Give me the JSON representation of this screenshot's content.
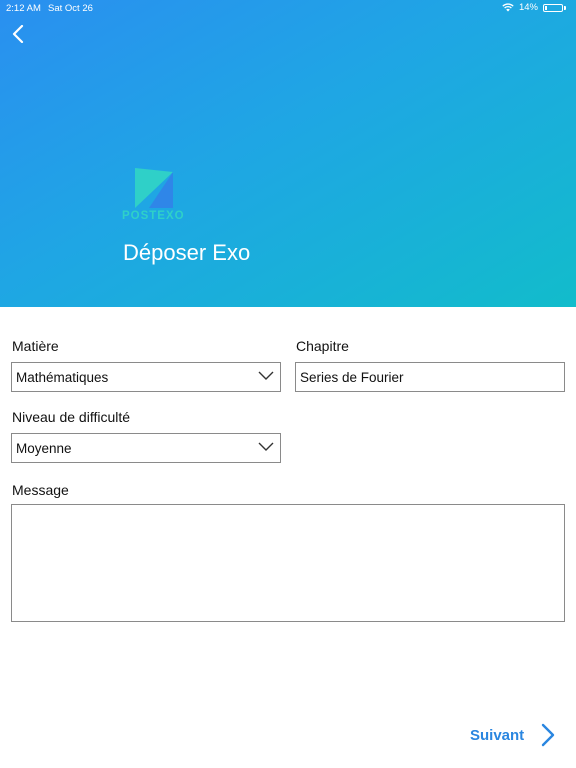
{
  "status_bar": {
    "time": "2:12 AM",
    "date": "Sat Oct 26",
    "battery": "14%",
    "battery_level": 0.14
  },
  "header": {
    "logo_text": "POSTEXO",
    "title": "Déposer Exo"
  },
  "form": {
    "subject": {
      "label": "Matière",
      "value": "Mathématiques"
    },
    "chapter": {
      "label": "Chapitre",
      "value": "Series de Fourier"
    },
    "difficulty": {
      "label": "Niveau de difficulté",
      "value": "Moyenne"
    },
    "message": {
      "label": "Message",
      "value": ""
    }
  },
  "actions": {
    "next_label": "Suivant"
  },
  "colors": {
    "accent": "#2a86e0",
    "header_start": "#2a8ff0",
    "header_end": "#12bccb",
    "logo_teal": "#2fd0c8"
  }
}
